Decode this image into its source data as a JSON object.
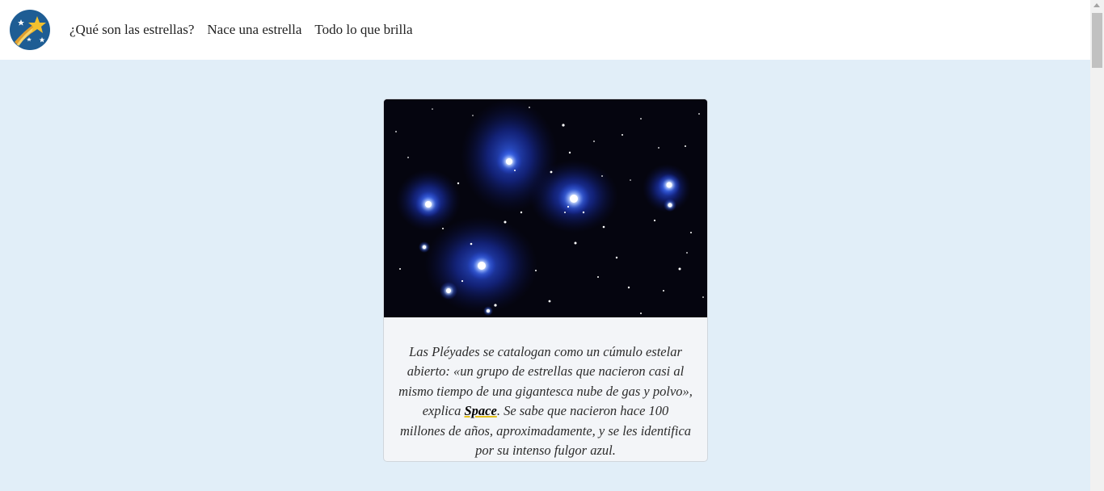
{
  "nav": {
    "logo_icon": "shooting-star-icon",
    "links": [
      "¿Qué son las estrellas?",
      "Nace una estrella",
      "Todo lo que brilla"
    ]
  },
  "card": {
    "image_subject": "pleiades-star-cluster",
    "caption_before": "Las Pléyades se catalogan como un cúmulo estelar abierto: «un grupo de estrellas que nacieron casi al mismo tiempo de una gigantesca nube de gas y polvo», explica ",
    "caption_link": "Space",
    "caption_after": ". Se sabe que nacieron hace 100 millones de años, aproximadamente, y se les identifica por su intenso fulgor azul."
  },
  "colors": {
    "background": "#e1eef8",
    "logo_bg": "#1e5d94",
    "star_yellow": "#f2c12e",
    "link_underline": "#e6c21c"
  }
}
